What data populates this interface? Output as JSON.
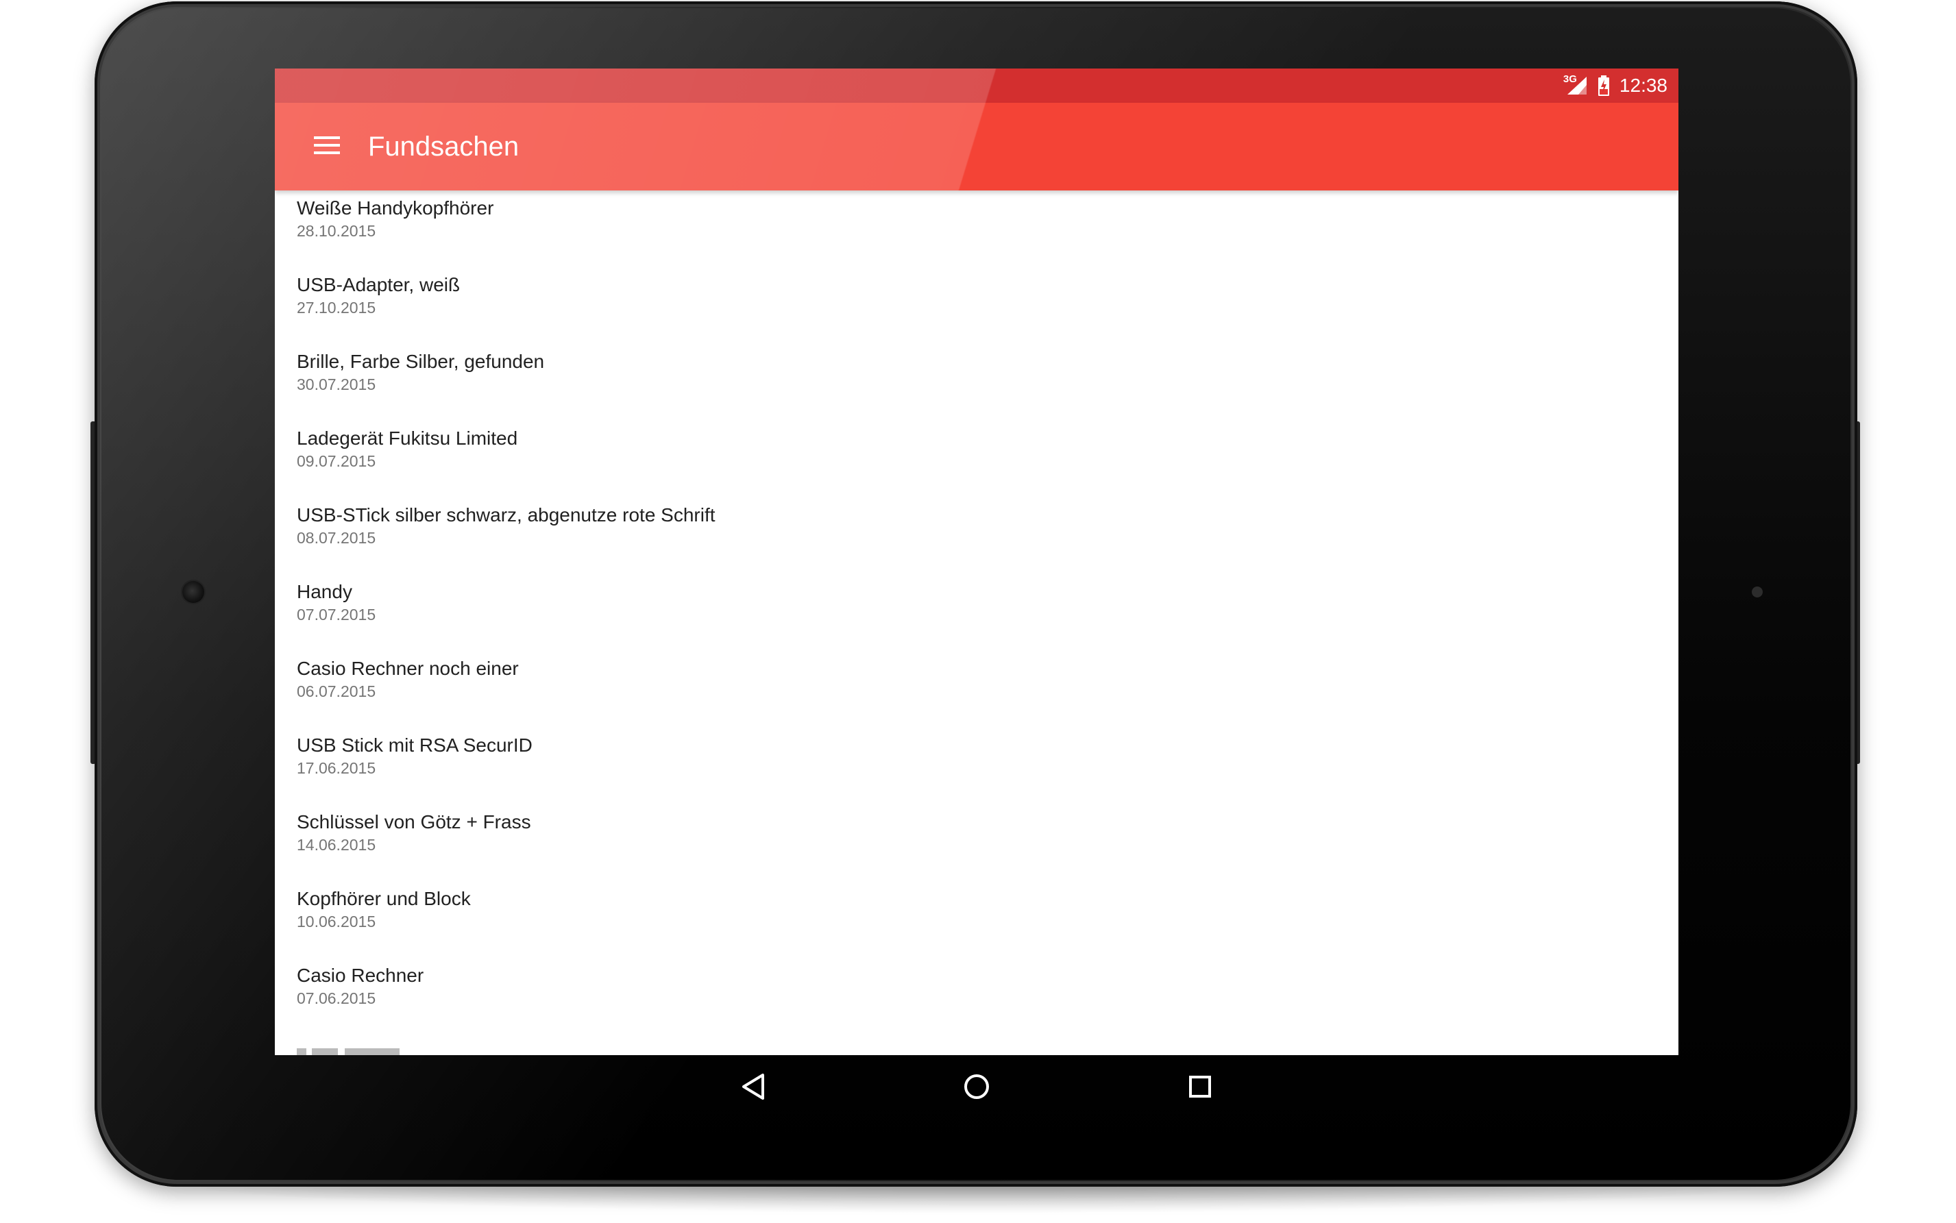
{
  "status_bar": {
    "network": "3G",
    "time": "12:38"
  },
  "app_bar": {
    "title": "Fundsachen",
    "menu_icon": "menu-icon"
  },
  "colors": {
    "primary": "#f44336",
    "primary_dark": "#d32f2f",
    "text_primary": "#212121",
    "text_secondary": "#757575"
  },
  "items": [
    {
      "title": "Weiße Handykopfhörer",
      "date": "28.10.2015"
    },
    {
      "title": "USB-Adapter, weiß",
      "date": "27.10.2015"
    },
    {
      "title": "Brille, Farbe Silber, gefunden",
      "date": "30.07.2015"
    },
    {
      "title": "Ladegerät Fukitsu Limited",
      "date": "09.07.2015"
    },
    {
      "title": "USB-STick silber schwarz, abgenutze rote Schrift",
      "date": "08.07.2015"
    },
    {
      "title": "Handy",
      "date": "07.07.2015"
    },
    {
      "title": "Casio Rechner noch einer",
      "date": "06.07.2015"
    },
    {
      "title": "USB Stick mit RSA SecurID",
      "date": "17.06.2015"
    },
    {
      "title": "Schlüssel von Götz + Frass",
      "date": "14.06.2015"
    },
    {
      "title": "Kopfhörer und Block",
      "date": "10.06.2015"
    },
    {
      "title": "Casio Rechner",
      "date": "07.06.2015"
    }
  ],
  "nav_bar": {
    "back_icon": "back-icon",
    "home_icon": "home-icon",
    "recents_icon": "recents-icon"
  }
}
